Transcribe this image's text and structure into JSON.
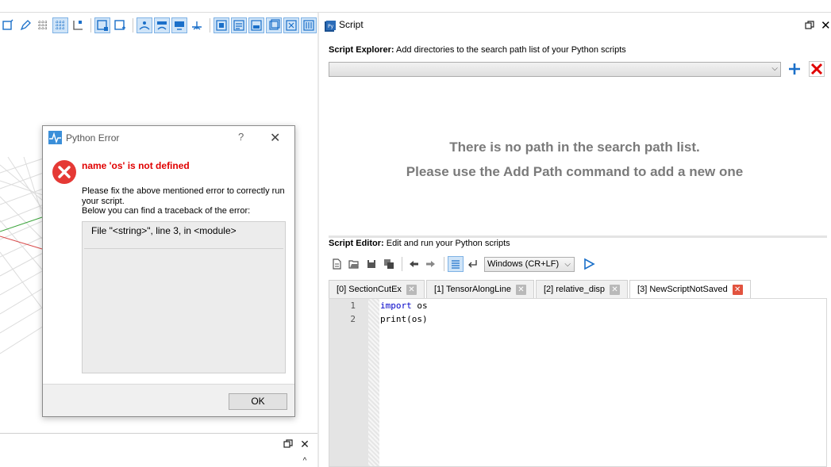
{
  "left_toolbar": {
    "icons": [
      "view-front-icon",
      "pen-icon",
      "grid-icon",
      "grid-active-icon",
      "grid-axes-icon",
      "select-box-icon",
      "select-box-plus-icon",
      "person-view-icon",
      "person-view-2-icon",
      "person-view-3-icon",
      "person-view-4-icon",
      "layer-1-icon",
      "layer-2-icon",
      "layer-3-icon",
      "layer-4-icon",
      "layer-5-icon",
      "layer-6-icon"
    ]
  },
  "dialog": {
    "title": "Python Error",
    "help": "?",
    "close": "✕",
    "error_message": "name 'os' is not defined",
    "body_line1": "Please fix the above mentioned error to correctly run your script.",
    "body_line2": "Below you can find a traceback of the error:",
    "traceback": "File \"<string>\", line 3, in <module>",
    "ok_label": "OK"
  },
  "script_panel": {
    "title": "Script",
    "explorer": {
      "label_bold": "Script Explorer:",
      "label_text": " Add directories to the search path list of your Python scripts",
      "empty_line1": "There is no path in the search path list.",
      "empty_line2": "Please use the Add Path command to add a new one"
    },
    "editor": {
      "label_bold": "Script Editor:",
      "label_text": " Edit and run your Python scripts",
      "eol_mode": "Windows (CR+LF)",
      "tabs": [
        {
          "label": "[0] SectionCutEx",
          "active": false
        },
        {
          "label": "[1] TensorAlongLine",
          "active": false
        },
        {
          "label": "[2] relative_disp",
          "active": false
        },
        {
          "label": "[3] NewScriptNotSaved",
          "active": true
        }
      ],
      "lines": [
        {
          "number": "1",
          "keyword": "import",
          "rest": " os"
        },
        {
          "number": "2",
          "keyword": "",
          "rest": "print(os)"
        }
      ]
    }
  },
  "colors": {
    "error_red": "#e00000",
    "accent_blue": "#1a6fc9",
    "keyword_blue": "#0000c8",
    "muted_gray": "#7a7a7a"
  }
}
